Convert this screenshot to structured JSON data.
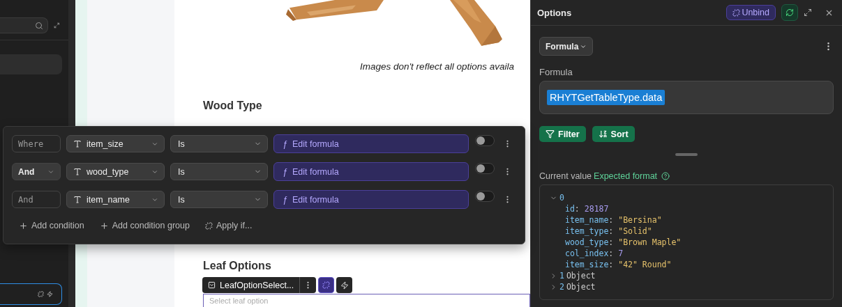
{
  "sidebar": {
    "items": [
      {
        "selected": false
      },
      {
        "selected": true
      }
    ]
  },
  "page": {
    "caption": "Images don't reflect all options availa",
    "heading": "Wood Type",
    "leaf_heading": "Leaf Options",
    "leaf_select": {
      "placeholder": "Select leaf option"
    }
  },
  "component_toolbar": {
    "name": "LeafOptionSelect..."
  },
  "filter": {
    "rows": [
      {
        "kind": "static",
        "joiner": "Where",
        "column": "item_size",
        "operator": "Is",
        "value_icon": "ƒ",
        "value": "Edit formula",
        "on": false
      },
      {
        "kind": "dropdown",
        "joiner": "And",
        "column": "wood_type",
        "operator": "Is",
        "value_icon": "ƒ",
        "value": "Edit formula",
        "on": false
      },
      {
        "kind": "static",
        "joiner": "And",
        "column": "item_name",
        "operator": "Is",
        "value_icon": "ƒ",
        "value": "Edit formula",
        "on": false
      }
    ],
    "actions": [
      {
        "kind": "plus",
        "label": "Add condition"
      },
      {
        "kind": "plus",
        "label": "Add condition group"
      },
      {
        "kind": "apply",
        "label": "Apply if..."
      }
    ]
  },
  "options": {
    "title": "Options",
    "unbind": "Unbind",
    "mode": "Formula",
    "formula_label": "Formula",
    "formula": "RHYTGetTableType.data",
    "buttons": [
      {
        "kind": "filter",
        "label": "Filter"
      },
      {
        "kind": "sort",
        "label": "Sort"
      }
    ],
    "current_value": "Current value",
    "expected_format": "Expected format",
    "tree": [
      {
        "key": "0",
        "expanded": true,
        "fields": [
          {
            "name": "id",
            "sep": ":",
            "value": "28187",
            "kind": "number"
          },
          {
            "name": "item_name",
            "sep": ":",
            "value": "\"Bersina\"",
            "kind": "string"
          },
          {
            "name": "item_type",
            "sep": ":",
            "value": "\"Solid\"",
            "kind": "string"
          },
          {
            "name": "wood_type",
            "sep": ":",
            "value": "\"Brown Maple\"",
            "kind": "string"
          },
          {
            "name": "col_index",
            "sep": ":",
            "value": "7",
            "kind": "number"
          },
          {
            "name": "item_size",
            "sep": ":",
            "value": "\"42\" Round\"",
            "kind": "string"
          }
        ]
      },
      {
        "key": "1",
        "expanded": false,
        "summary": "Object"
      },
      {
        "key": "2",
        "expanded": false,
        "summary": "Object"
      }
    ]
  }
}
